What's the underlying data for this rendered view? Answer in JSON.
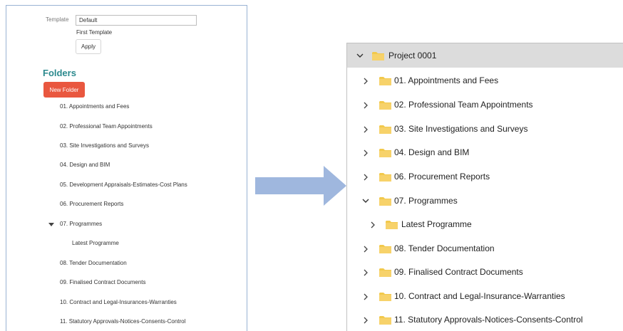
{
  "template_panel": {
    "label": "Template",
    "input_value": "Default",
    "option": "First Template",
    "apply_label": "Apply"
  },
  "folders_panel": {
    "heading": "Folders",
    "new_folder_label": "New Folder",
    "items": [
      "01. Appointments and Fees",
      "02. Professional Team Appointments",
      "03. Site Investigations and Surveys",
      "04. Design and BIM",
      "05. Development Appraisals-Estimates-Cost Plans",
      "06. Procurement Reports",
      "07. Programmes",
      "Latest Programme",
      "08. Tender Documentation",
      "09. Finalised Contract Documents",
      "10. Contract and Legal-Insurances-Warranties",
      "11. Statutory Approvals-Notices-Consents-Control"
    ]
  },
  "tree_panel": {
    "root": "Project 0001",
    "items": [
      "01. Appointments and Fees",
      "02. Professional Team Appointments",
      "03. Site Investigations and Surveys",
      "04. Design and BIM",
      "06. Procurement Reports",
      "07. Programmes",
      "Latest Programme",
      "08. Tender Documentation",
      "09. Finalised Contract Documents",
      "10. Contract and Legal-Insurance-Warranties",
      "11. Statutory Approvals-Notices-Consents-Control"
    ]
  },
  "colors": {
    "accent_teal": "#2c8a8e",
    "new_folder_red": "#e9573f",
    "folder_yellow": "#f2c94c",
    "arrow_blue": "#9fb7de"
  }
}
